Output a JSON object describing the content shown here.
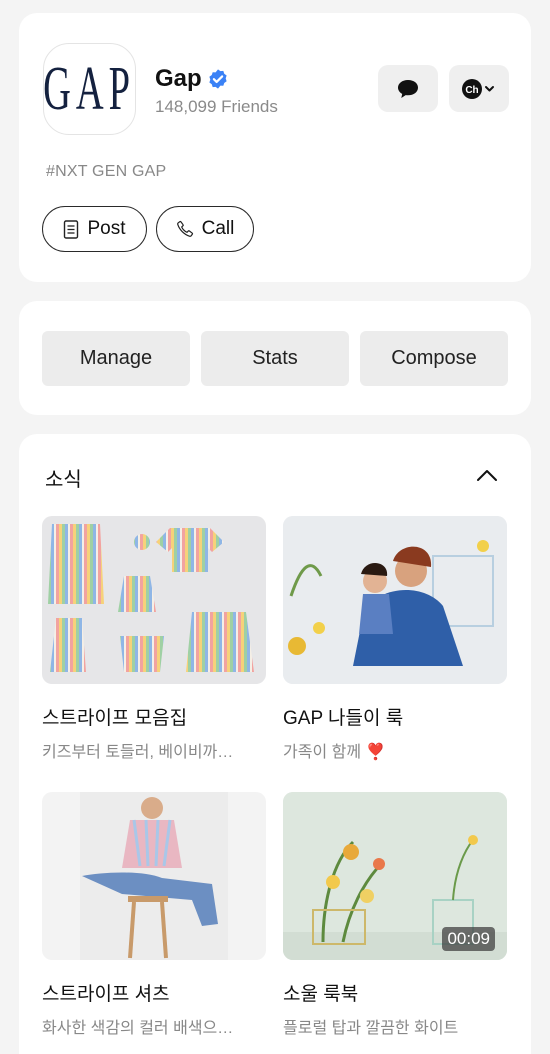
{
  "profile": {
    "logo_text": "GAP",
    "name": "Gap",
    "friends": "148,099 Friends",
    "tagline": "#NXT GEN GAP",
    "post_label": "Post",
    "call_label": "Call",
    "chat_icon": "speech-bubble-icon",
    "channel_icon": "channel-dropdown-icon",
    "channel_icon_text": "Ch",
    "verified_color": "#3b82f6"
  },
  "actions": {
    "manage_label": "Manage",
    "stats_label": "Stats",
    "compose_label": "Compose"
  },
  "news": {
    "title": "소식",
    "items": [
      {
        "title": "스트라이프 모음집",
        "desc": "키즈부터 토들러, 베이비까…"
      },
      {
        "title": "GAP 나들이 룩",
        "desc": "가족이 함께 ❣️"
      },
      {
        "title": "스트라이프 셔츠",
        "desc": "화사한 색감의 컬러 배색으…"
      },
      {
        "title": "소울 룩북",
        "desc": "플로럴 탑과 깔끔한 화이트",
        "duration": "00:09"
      }
    ]
  }
}
